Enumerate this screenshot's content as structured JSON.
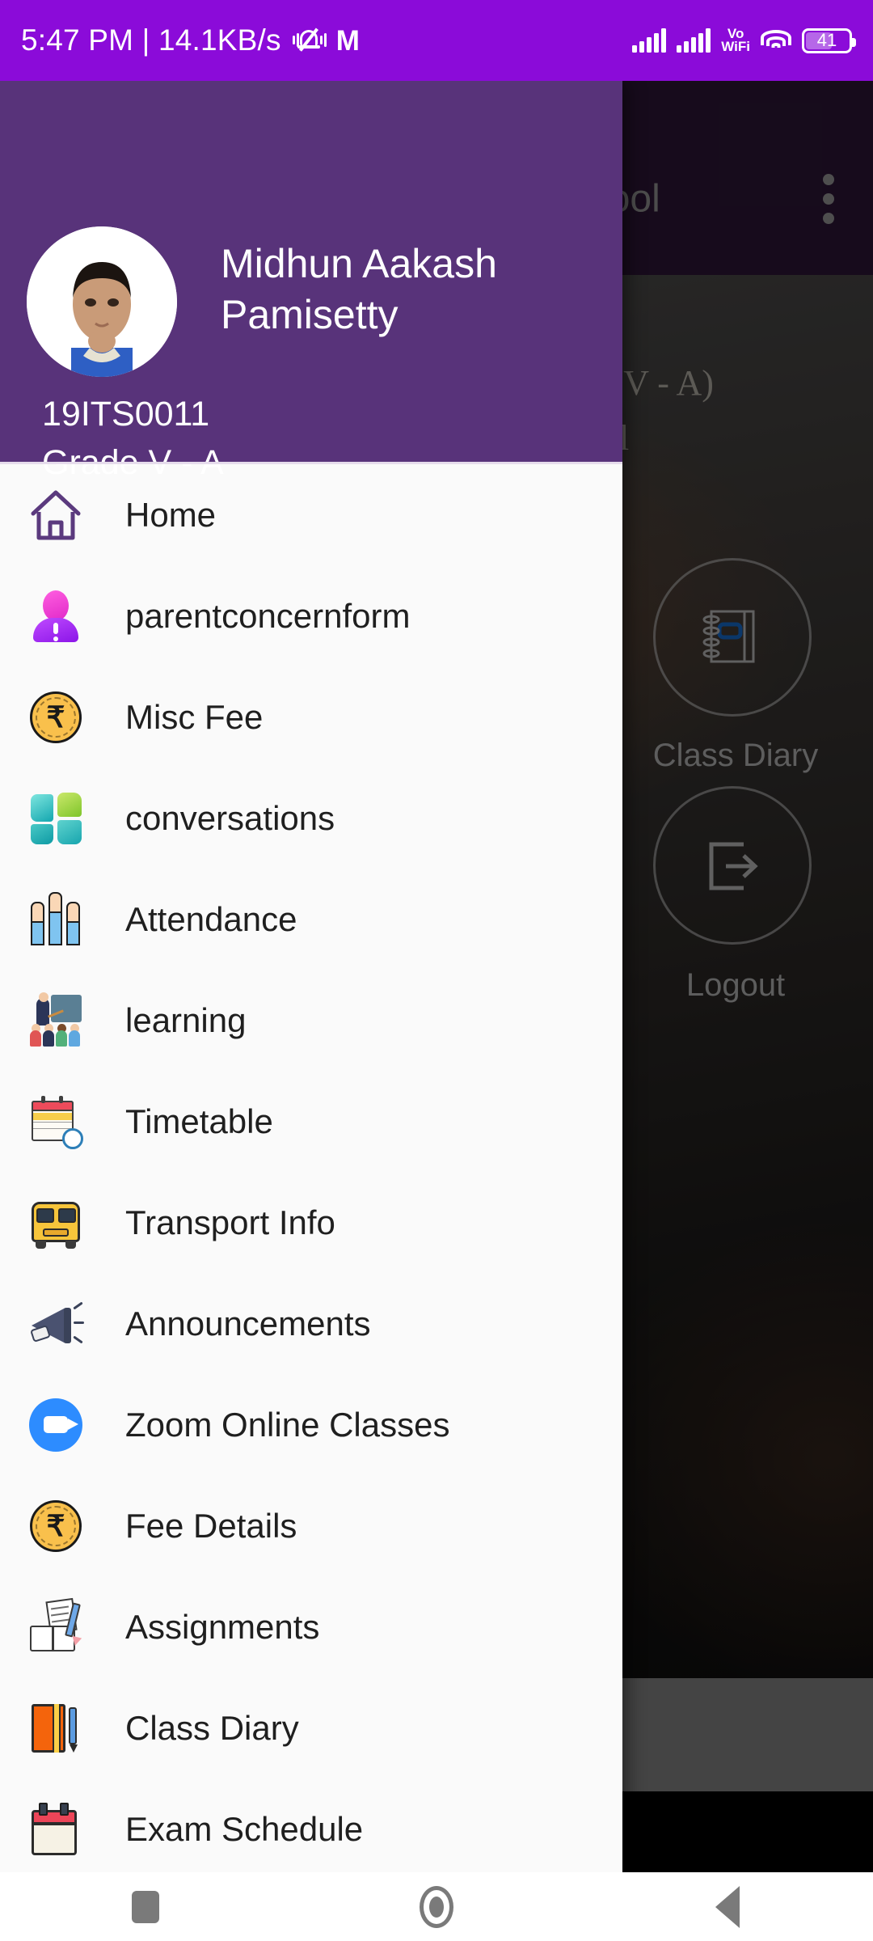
{
  "status_bar": {
    "time_and_speed": "5:47 PM | 14.1KB/s",
    "mute_icon": "bell-mute-vibrate-icon",
    "brand_logo": "M",
    "vowifi_line1": "Vo",
    "vowifi_line2": "WiFi",
    "wifi_icon": "wifi-icon",
    "battery_percent": "41",
    "background_color": "#8B0BD9"
  },
  "background_app": {
    "appbar": {
      "title": "School",
      "overflow_icon": "kebab-menu-icon",
      "background_color": "#2A1533"
    },
    "heading_line1": "ade V - A)",
    "heading_line2": "hool",
    "actions": [
      {
        "label": "Class Diary",
        "icon": "spiral-notebook-icon"
      },
      {
        "label": "Logout",
        "icon": "exit-arrow-icon"
      }
    ],
    "footer": {
      "social_icon": "instagram-icon"
    }
  },
  "drawer": {
    "header": {
      "avatar": "student-photo-avatar",
      "name": "Midhun Aakash Pamisetty",
      "student_id": "19ITS0011",
      "grade": "Grade V - A",
      "background_color": "#58337A"
    },
    "menu_items": [
      {
        "label": "Home",
        "icon": "home-icon"
      },
      {
        "label": "parentconcernform",
        "icon": "person-alert-icon"
      },
      {
        "label": "Misc Fee",
        "icon": "rupee-coin-icon"
      },
      {
        "label": "conversations",
        "icon": "chat-tiles-icon"
      },
      {
        "label": "Attendance",
        "icon": "raised-hands-icon"
      },
      {
        "label": "learning",
        "icon": "teacher-classroom-icon"
      },
      {
        "label": "Timetable",
        "icon": "calendar-clock-icon"
      },
      {
        "label": "Transport Info",
        "icon": "school-bus-icon"
      },
      {
        "label": "Announcements",
        "icon": "megaphone-icon"
      },
      {
        "label": "Zoom Online Classes",
        "icon": "zoom-video-icon"
      },
      {
        "label": "Fee Details",
        "icon": "rupee-coin-icon"
      },
      {
        "label": "Assignments",
        "icon": "notebook-pencil-icon"
      },
      {
        "label": "Class Diary",
        "icon": "orange-diary-icon"
      },
      {
        "label": "Exam Schedule",
        "icon": "red-calendar-icon"
      }
    ]
  },
  "navigation_bar": {
    "recents": "square-recents-icon",
    "home": "circle-home-icon",
    "back": "triangle-back-icon"
  }
}
